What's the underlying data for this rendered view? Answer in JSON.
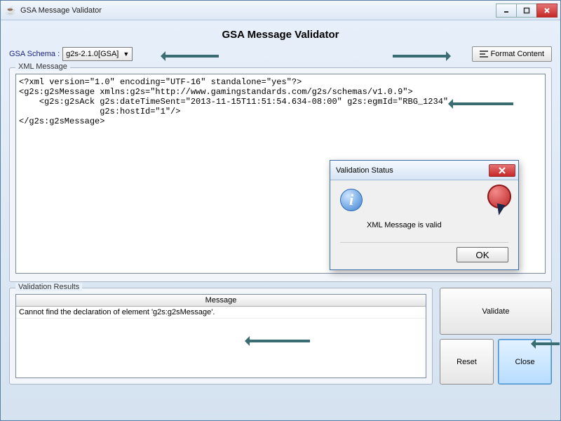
{
  "window": {
    "title": "GSA Message Validator",
    "heading": "GSA Message Validator"
  },
  "schema": {
    "label": "GSA Schema :",
    "selected": "g2s-2.1.0[GSA]"
  },
  "buttons": {
    "format": "Format Content",
    "validate": "Validate",
    "reset": "Reset",
    "close": "Close",
    "ok": "OK"
  },
  "groups": {
    "xml": "XML Message",
    "results": "Validation Results"
  },
  "xml_content": "<?xml version=\"1.0\" encoding=\"UTF-16\" standalone=\"yes\"?>\n<g2s:g2sMessage xmlns:g2s=\"http://www.gamingstandards.com/g2s/schemas/v1.0.9\">\n    <g2s:g2sAck g2s:dateTimeSent=\"2013-11-15T11:51:54.634-08:00\" g2s:egmId=\"RBG_1234\"\n                g2s:hostId=\"1\"/>\n</g2s:g2sMessage>",
  "results": {
    "header": "Message",
    "rows": [
      "Cannot find the declaration of element 'g2s:g2sMessage'."
    ]
  },
  "dialog": {
    "title": "Validation Status",
    "message": "XML Message is valid"
  }
}
